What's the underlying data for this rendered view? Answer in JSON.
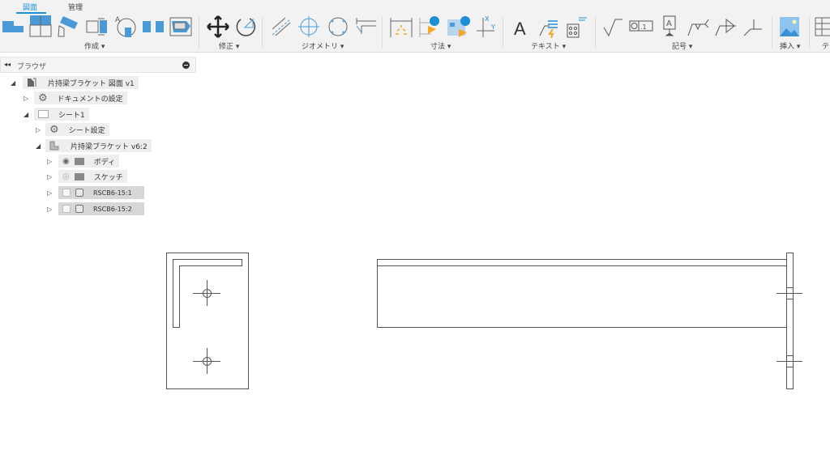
{
  "tabs": [
    {
      "label": "図面",
      "active": true
    },
    {
      "label": "管理",
      "active": false
    }
  ],
  "groups": [
    {
      "label": "作成 ▾"
    },
    {
      "label": "修正 ▾"
    },
    {
      "label": "ジオメトリ ▾"
    },
    {
      "label": "寸法 ▾"
    },
    {
      "label": "テキスト ▾"
    },
    {
      "label": "記号 ▾"
    },
    {
      "label": "挿入 ▾"
    },
    {
      "label": "テ"
    }
  ],
  "browser": {
    "title": "ブラウザ",
    "collapse_icon": "double-chevron-left-icon",
    "close_icon": "minus-circle-icon"
  },
  "tree": [
    {
      "label": "片持梁ブラケット 図面 v1",
      "icon": "drawing-icon"
    },
    {
      "label": "ドキュメントの設定",
      "icon": "gear-icon"
    },
    {
      "label": "シート1",
      "icon": "sheet-icon"
    },
    {
      "label": "シート設定",
      "icon": "gear-icon"
    },
    {
      "label": "片持梁ブラケット v6:2",
      "icon": "component-icon"
    },
    {
      "label": "ボディ",
      "icon": "folder-icon"
    },
    {
      "label": "スケッチ",
      "icon": "folder-icon"
    },
    {
      "label": "RSCB6-15:1",
      "icon": "body-icon"
    },
    {
      "label": "RSCB6-15:2",
      "icon": "body-icon"
    }
  ],
  "colors": {
    "accent": "#1a8fd6",
    "icon_blue": "#4a9ad8",
    "icon_orange": "#f5a623"
  }
}
